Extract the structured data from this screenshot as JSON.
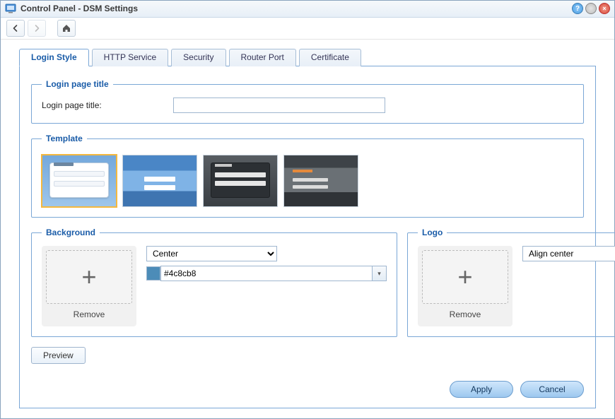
{
  "window": {
    "title": "Control Panel - DSM Settings"
  },
  "tabs": [
    {
      "label": "Login Style",
      "active": true
    },
    {
      "label": "HTTP Service",
      "active": false
    },
    {
      "label": "Security",
      "active": false
    },
    {
      "label": "Router Port",
      "active": false
    },
    {
      "label": "Certificate",
      "active": false
    }
  ],
  "login_title_section": {
    "legend": "Login page title",
    "label": "Login page title:",
    "value": ""
  },
  "template_section": {
    "legend": "Template"
  },
  "background_section": {
    "legend": "Background",
    "remove_label": "Remove",
    "position_value": "Center",
    "color_value": "#4c8cb8"
  },
  "logo_section": {
    "legend": "Logo",
    "remove_label": "Remove",
    "align_value": "Align center"
  },
  "preview_label": "Preview",
  "footer": {
    "apply": "Apply",
    "cancel": "Cancel"
  }
}
